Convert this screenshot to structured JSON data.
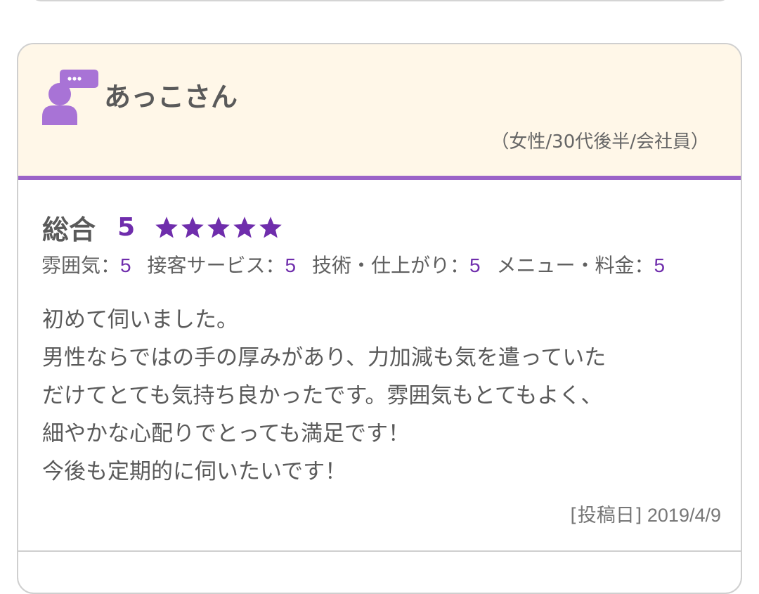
{
  "review": {
    "reviewer_name": "あっこさん",
    "reviewer_profile": "（女性/30代後半/会社員）",
    "avatar_icon": "user-comment-icon",
    "overall_label": "総合",
    "overall_score": "5",
    "overall_rating": 5,
    "rating_max": 5,
    "star_icon": "star-icon",
    "sub_ratings": [
      {
        "label": "雰囲気：",
        "value": "5"
      },
      {
        "label": "接客サービス：",
        "value": "5"
      },
      {
        "label": "技術・仕上がり：",
        "value": "5"
      },
      {
        "label": "メニュー・料金：",
        "value": "5"
      }
    ],
    "comment": "初めて伺いました。\n男性ならではの手の厚みがあり、力加減も気を遣っていた\nだけてとても気持ち良かったです。雰囲気もとてもよく、\n細やかな心配りでとっても満足です！\n今後も定期的に伺いたいです！",
    "post_date_label": "[投稿日]",
    "post_date": "2019/4/9"
  },
  "colors": {
    "accent": "#6f2dac",
    "header_background": "#fff7e8",
    "header_border": "#9b63c8",
    "avatar": "#a873d6"
  }
}
